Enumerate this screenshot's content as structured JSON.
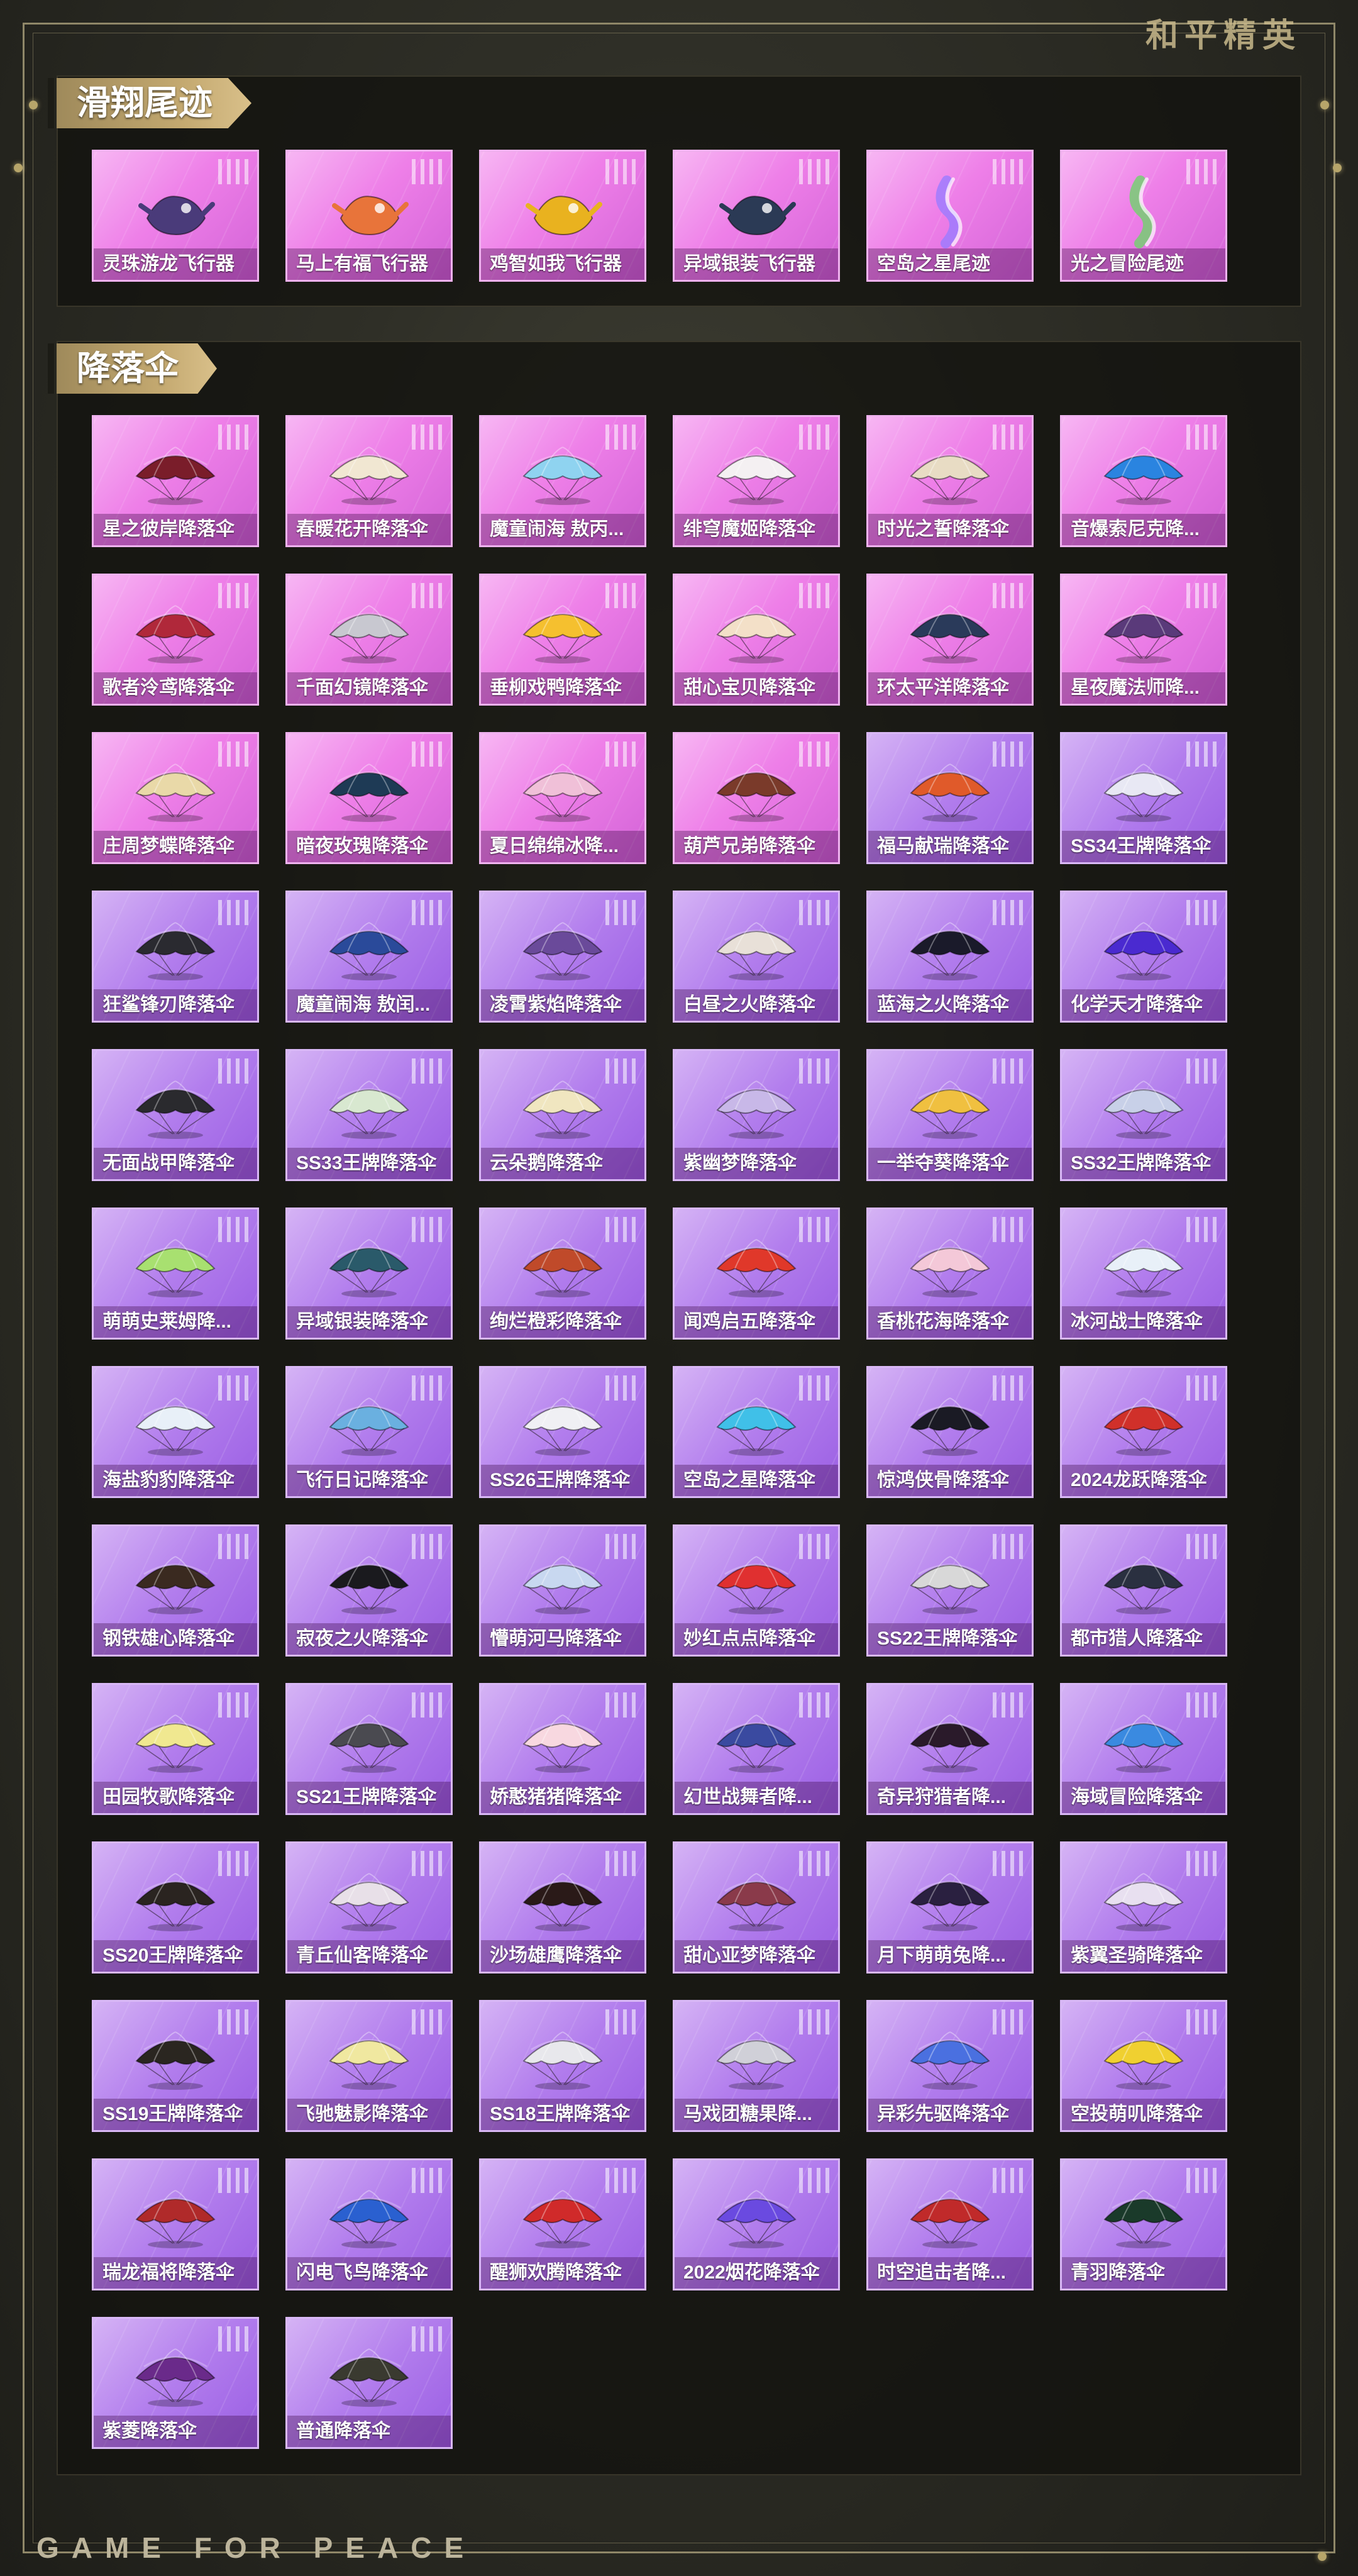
{
  "brand": {
    "logo_text": "和平精英",
    "footer_text": "GAME FOR PEACE"
  },
  "colors": {
    "card_pink": "#ee7fe8",
    "card_purple": "#b27ded",
    "title_gold": "#c4a970",
    "panel_bg": "#12120e"
  },
  "sections": {
    "trails": {
      "title": "滑翔尾迹",
      "items": [
        {
          "label": "灵珠游龙飞行器",
          "icon": "dragon-glider-icon",
          "color": "#4a3b7a",
          "style": "pink"
        },
        {
          "label": "马上有福飞行器",
          "icon": "horse-glider-icon",
          "color": "#e8743a",
          "style": "pink"
        },
        {
          "label": "鸡智如我飞行器",
          "icon": "rooster-glider-icon",
          "color": "#e9b21f",
          "style": "pink"
        },
        {
          "label": "异域银装飞行器",
          "icon": "mecha-glider-icon",
          "color": "#2b3a55",
          "style": "pink"
        },
        {
          "label": "空岛之星尾迹",
          "icon": "rainbow-trail-icon",
          "color": "#9a7cff",
          "style": "pink"
        },
        {
          "label": "光之冒险尾迹",
          "icon": "green-trail-icon",
          "color": "#6fd36b",
          "style": "pink"
        }
      ]
    },
    "parachutes": {
      "title": "降落伞",
      "items": [
        {
          "label": "星之彼岸降落伞",
          "icon": "parachute-icon",
          "color": "#7a1d2a",
          "style": "pink"
        },
        {
          "label": "春暖花开降落伞",
          "icon": "parachute-icon",
          "color": "#f1e7d2",
          "style": "pink"
        },
        {
          "label": "魔童闹海 敖丙...",
          "icon": "parachute-icon",
          "color": "#8fd3f0",
          "style": "pink"
        },
        {
          "label": "绯穹魔姬降落伞",
          "icon": "parachute-icon",
          "color": "#f4f0f2",
          "style": "pink"
        },
        {
          "label": "时光之誓降落伞",
          "icon": "parachute-icon",
          "color": "#e8dcc4",
          "style": "pink"
        },
        {
          "label": "音爆索尼克降...",
          "icon": "parachute-icon",
          "color": "#2a84e0",
          "style": "pink"
        },
        {
          "label": "歌者泠鸢降落伞",
          "icon": "parachute-icon",
          "color": "#b0283a",
          "style": "pink"
        },
        {
          "label": "千面幻镜降落伞",
          "icon": "parachute-icon",
          "color": "#c8c8d0",
          "style": "pink"
        },
        {
          "label": "垂柳戏鸭降落伞",
          "icon": "parachute-icon",
          "color": "#f5c02f",
          "style": "pink"
        },
        {
          "label": "甜心宝贝降落伞",
          "icon": "parachute-icon",
          "color": "#f3e0c8",
          "style": "pink"
        },
        {
          "label": "环太平洋降落伞",
          "icon": "parachute-icon",
          "color": "#2a3a5a",
          "style": "pink"
        },
        {
          "label": "星夜魔法师降...",
          "icon": "parachute-icon",
          "color": "#5a3a7a",
          "style": "pink"
        },
        {
          "label": "庄周梦蝶降落伞",
          "icon": "parachute-icon",
          "color": "#e9d9a8",
          "style": "pink"
        },
        {
          "label": "暗夜玫瑰降落伞",
          "icon": "parachute-icon",
          "color": "#1e3a55",
          "style": "pink"
        },
        {
          "label": "夏日绵绵冰降...",
          "icon": "parachute-icon",
          "color": "#f0c0d8",
          "style": "pink"
        },
        {
          "label": "葫芦兄弟降落伞",
          "icon": "parachute-icon",
          "color": "#7a3a2a",
          "style": "pink"
        },
        {
          "label": "福马献瑞降落伞",
          "icon": "parachute-icon",
          "color": "#e05a2a",
          "style": "purple"
        },
        {
          "label": "SS34王牌降落伞",
          "icon": "parachute-icon",
          "color": "#e8e8f4",
          "style": "purple"
        },
        {
          "label": "狂鲨锋刃降落伞",
          "icon": "parachute-icon",
          "color": "#2a2a30",
          "style": "purple"
        },
        {
          "label": "魔童闹海 敖闰...",
          "icon": "parachute-icon",
          "color": "#2a4a9a",
          "style": "purple"
        },
        {
          "label": "凌霄紫焰降落伞",
          "icon": "parachute-icon",
          "color": "#6a4a9a",
          "style": "purple"
        },
        {
          "label": "白昼之火降落伞",
          "icon": "parachute-icon",
          "color": "#e8e0d8",
          "style": "purple"
        },
        {
          "label": "蓝海之火降落伞",
          "icon": "parachute-icon",
          "color": "#1a1a2a",
          "style": "purple"
        },
        {
          "label": "化学天才降落伞",
          "icon": "parachute-icon",
          "color": "#4a2ad0",
          "style": "purple"
        },
        {
          "label": "无面战甲降落伞",
          "icon": "parachute-icon",
          "color": "#2a2a2e",
          "style": "purple"
        },
        {
          "label": "SS33王牌降落伞",
          "icon": "parachute-icon",
          "color": "#d8e8d0",
          "style": "purple"
        },
        {
          "label": "云朵鹅降落伞",
          "icon": "parachute-icon",
          "color": "#f0e6c0",
          "style": "purple"
        },
        {
          "label": "紫幽梦降落伞",
          "icon": "parachute-icon",
          "color": "#c8b8e8",
          "style": "purple"
        },
        {
          "label": "一举夺葵降落伞",
          "icon": "parachute-icon",
          "color": "#f0c040",
          "style": "purple"
        },
        {
          "label": "SS32王牌降落伞",
          "icon": "parachute-icon",
          "color": "#c8d0e8",
          "style": "purple"
        },
        {
          "label": "萌萌史莱姆降...",
          "icon": "parachute-icon",
          "color": "#a8e070",
          "style": "purple"
        },
        {
          "label": "异域银装降落伞",
          "icon": "parachute-icon",
          "color": "#2a5a6a",
          "style": "purple"
        },
        {
          "label": "绚烂橙彩降落伞",
          "icon": "parachute-icon",
          "color": "#c04a2a",
          "style": "purple"
        },
        {
          "label": "闻鸡启五降落伞",
          "icon": "parachute-icon",
          "color": "#e0382a",
          "style": "purple"
        },
        {
          "label": "香桃花海降落伞",
          "icon": "parachute-icon",
          "color": "#f4c8d8",
          "style": "purple"
        },
        {
          "label": "冰河战士降落伞",
          "icon": "parachute-icon",
          "color": "#e8f0f8",
          "style": "purple"
        },
        {
          "label": "海盐豹豹降落伞",
          "icon": "parachute-icon",
          "color": "#e8f0f8",
          "style": "purple"
        },
        {
          "label": "飞行日记降落伞",
          "icon": "parachute-icon",
          "color": "#6ab0e0",
          "style": "purple"
        },
        {
          "label": "SS26王牌降落伞",
          "icon": "parachute-icon",
          "color": "#f0f0f4",
          "style": "purple"
        },
        {
          "label": "空岛之星降落伞",
          "icon": "parachute-icon",
          "color": "#40c0e8",
          "style": "purple"
        },
        {
          "label": "惊鸿侠骨降落伞",
          "icon": "parachute-icon",
          "color": "#1a1a24",
          "style": "purple"
        },
        {
          "label": "2024龙跃降落伞",
          "icon": "parachute-icon",
          "color": "#d0302a",
          "style": "purple"
        },
        {
          "label": "钢铁雄心降落伞",
          "icon": "parachute-icon",
          "color": "#3a2a20",
          "style": "purple"
        },
        {
          "label": "寂夜之火降落伞",
          "icon": "parachute-icon",
          "color": "#1a1a1e",
          "style": "purple"
        },
        {
          "label": "懵萌河马降落伞",
          "icon": "parachute-icon",
          "color": "#c8d8f0",
          "style": "purple"
        },
        {
          "label": "妙红点点降落伞",
          "icon": "parachute-icon",
          "color": "#e03030",
          "style": "purple"
        },
        {
          "label": "SS22王牌降落伞",
          "icon": "parachute-icon",
          "color": "#d8d8d8",
          "style": "purple"
        },
        {
          "label": "都市猎人降落伞",
          "icon": "parachute-icon",
          "color": "#2a3040",
          "style": "purple"
        },
        {
          "label": "田园牧歌降落伞",
          "icon": "parachute-icon",
          "color": "#f0e890",
          "style": "purple"
        },
        {
          "label": "SS21王牌降落伞",
          "icon": "parachute-icon",
          "color": "#4a4a50",
          "style": "purple"
        },
        {
          "label": "娇憨猪猪降落伞",
          "icon": "parachute-icon",
          "color": "#f8d8e0",
          "style": "purple"
        },
        {
          "label": "幻世战舞者降...",
          "icon": "parachute-icon",
          "color": "#3a4aa0",
          "style": "purple"
        },
        {
          "label": "奇异狩猎者降...",
          "icon": "parachute-icon",
          "color": "#2a1a2a",
          "style": "purple"
        },
        {
          "label": "海域冒险降落伞",
          "icon": "parachute-icon",
          "color": "#3a8ae0",
          "style": "purple"
        },
        {
          "label": "SS20王牌降落伞",
          "icon": "parachute-icon",
          "color": "#2a2420",
          "style": "purple"
        },
        {
          "label": "青丘仙客降落伞",
          "icon": "parachute-icon",
          "color": "#e8e0e8",
          "style": "purple"
        },
        {
          "label": "沙场雄鹰降落伞",
          "icon": "parachute-icon",
          "color": "#2a1a18",
          "style": "purple"
        },
        {
          "label": "甜心亚梦降落伞",
          "icon": "parachute-icon",
          "color": "#8a3a4a",
          "style": "purple"
        },
        {
          "label": "月下萌萌兔降...",
          "icon": "parachute-icon",
          "color": "#2a2040",
          "style": "purple"
        },
        {
          "label": "紫翼圣骑降落伞",
          "icon": "parachute-icon",
          "color": "#e8e0f0",
          "style": "purple"
        },
        {
          "label": "SS19王牌降落伞",
          "icon": "parachute-icon",
          "color": "#2a2620",
          "style": "purple"
        },
        {
          "label": "飞驰魅影降落伞",
          "icon": "parachute-icon",
          "color": "#f0e8a0",
          "style": "purple"
        },
        {
          "label": "SS18王牌降落伞",
          "icon": "parachute-icon",
          "color": "#e8e8ec",
          "style": "purple"
        },
        {
          "label": "马戏团糖果降...",
          "icon": "parachute-icon",
          "color": "#d0d0d8",
          "style": "purple"
        },
        {
          "label": "异彩先驱降落伞",
          "icon": "parachute-icon",
          "color": "#4a70e0",
          "style": "purple"
        },
        {
          "label": "空投萌叽降落伞",
          "icon": "parachute-icon",
          "color": "#f0d030",
          "style": "purple"
        },
        {
          "label": "瑞龙福将降落伞",
          "icon": "parachute-icon",
          "color": "#b02a2a",
          "style": "purple"
        },
        {
          "label": "闪电飞鸟降落伞",
          "icon": "parachute-icon",
          "color": "#2a60d0",
          "style": "purple"
        },
        {
          "label": "醒狮欢腾降落伞",
          "icon": "parachute-icon",
          "color": "#d02a2a",
          "style": "purple"
        },
        {
          "label": "2022烟花降落伞",
          "icon": "parachute-icon",
          "color": "#6a4ae0",
          "style": "purple"
        },
        {
          "label": "时空追击者降...",
          "icon": "parachute-icon",
          "color": "#c02a2a",
          "style": "purple"
        },
        {
          "label": "青羽降落伞",
          "icon": "parachute-icon",
          "color": "#1a3a2a",
          "style": "purple"
        },
        {
          "label": "紫菱降落伞",
          "icon": "parachute-icon",
          "color": "#6a2a8a",
          "style": "purple"
        },
        {
          "label": "普通降落伞",
          "icon": "parachute-icon",
          "color": "#3a3a30",
          "style": "purple"
        }
      ]
    }
  }
}
